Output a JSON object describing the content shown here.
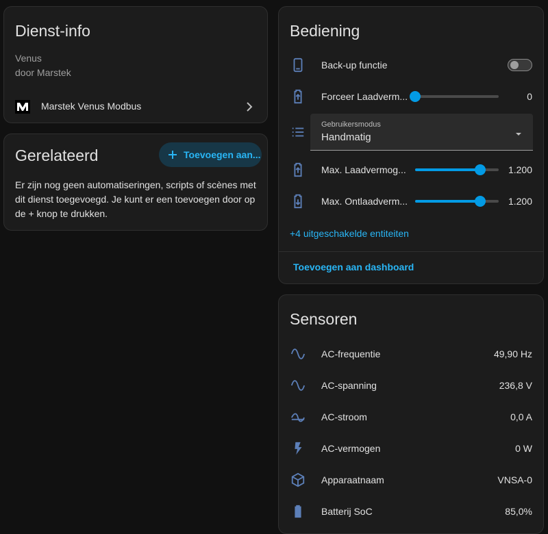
{
  "service_info": {
    "title": "Dienst-info",
    "model": "Venus",
    "manufacturer": "door Marstek",
    "integration": "Marstek Venus Modbus"
  },
  "related": {
    "title": "Gerelateerd",
    "add_button": "Toevoegen aan...",
    "empty_text": "Er zijn nog geen automatiseringen, scripts of scènes met dit dienst toegevoegd. Je kunt er een toevoegen door op de + knop te drukken."
  },
  "controls": {
    "title": "Bediening",
    "backup": {
      "label": "Back-up functie",
      "state": "off"
    },
    "force_charge": {
      "label": "Forceer Laadverm...",
      "value": "0",
      "fraction": 0.0
    },
    "user_mode": {
      "label": "Gebruikersmodus",
      "value": "Handmatig"
    },
    "max_charge": {
      "label": "Max. Laadvermog...",
      "value": "1.200",
      "fraction": 0.78
    },
    "max_discharge": {
      "label": "Max. Ontlaadverm...",
      "value": "1.200",
      "fraction": 0.78
    },
    "disabled_entities": "+4 uitgeschakelde entiteiten",
    "add_dashboard": "Toevoegen aan dashboard"
  },
  "sensors": {
    "title": "Sensoren",
    "items": [
      {
        "label": "AC-frequentie",
        "value": "49,90 Hz",
        "icon": "sine-wave-icon"
      },
      {
        "label": "AC-spanning",
        "value": "236,8 V",
        "icon": "sine-wave-icon"
      },
      {
        "label": "AC-stroom",
        "value": "0,0 A",
        "icon": "current-ac-icon"
      },
      {
        "label": "AC-vermogen",
        "value": "0 W",
        "icon": "flash-icon"
      },
      {
        "label": "Apparaatnaam",
        "value": "VNSA-0",
        "icon": "cube-icon"
      },
      {
        "label": "Batterij SoC",
        "value": "85,0%",
        "icon": "battery-icon"
      }
    ]
  },
  "colors": {
    "accent": "#039be5",
    "link": "#29b6f6",
    "icon": "#5c7fb8",
    "card": "#1c1c1c",
    "background": "#111111"
  }
}
